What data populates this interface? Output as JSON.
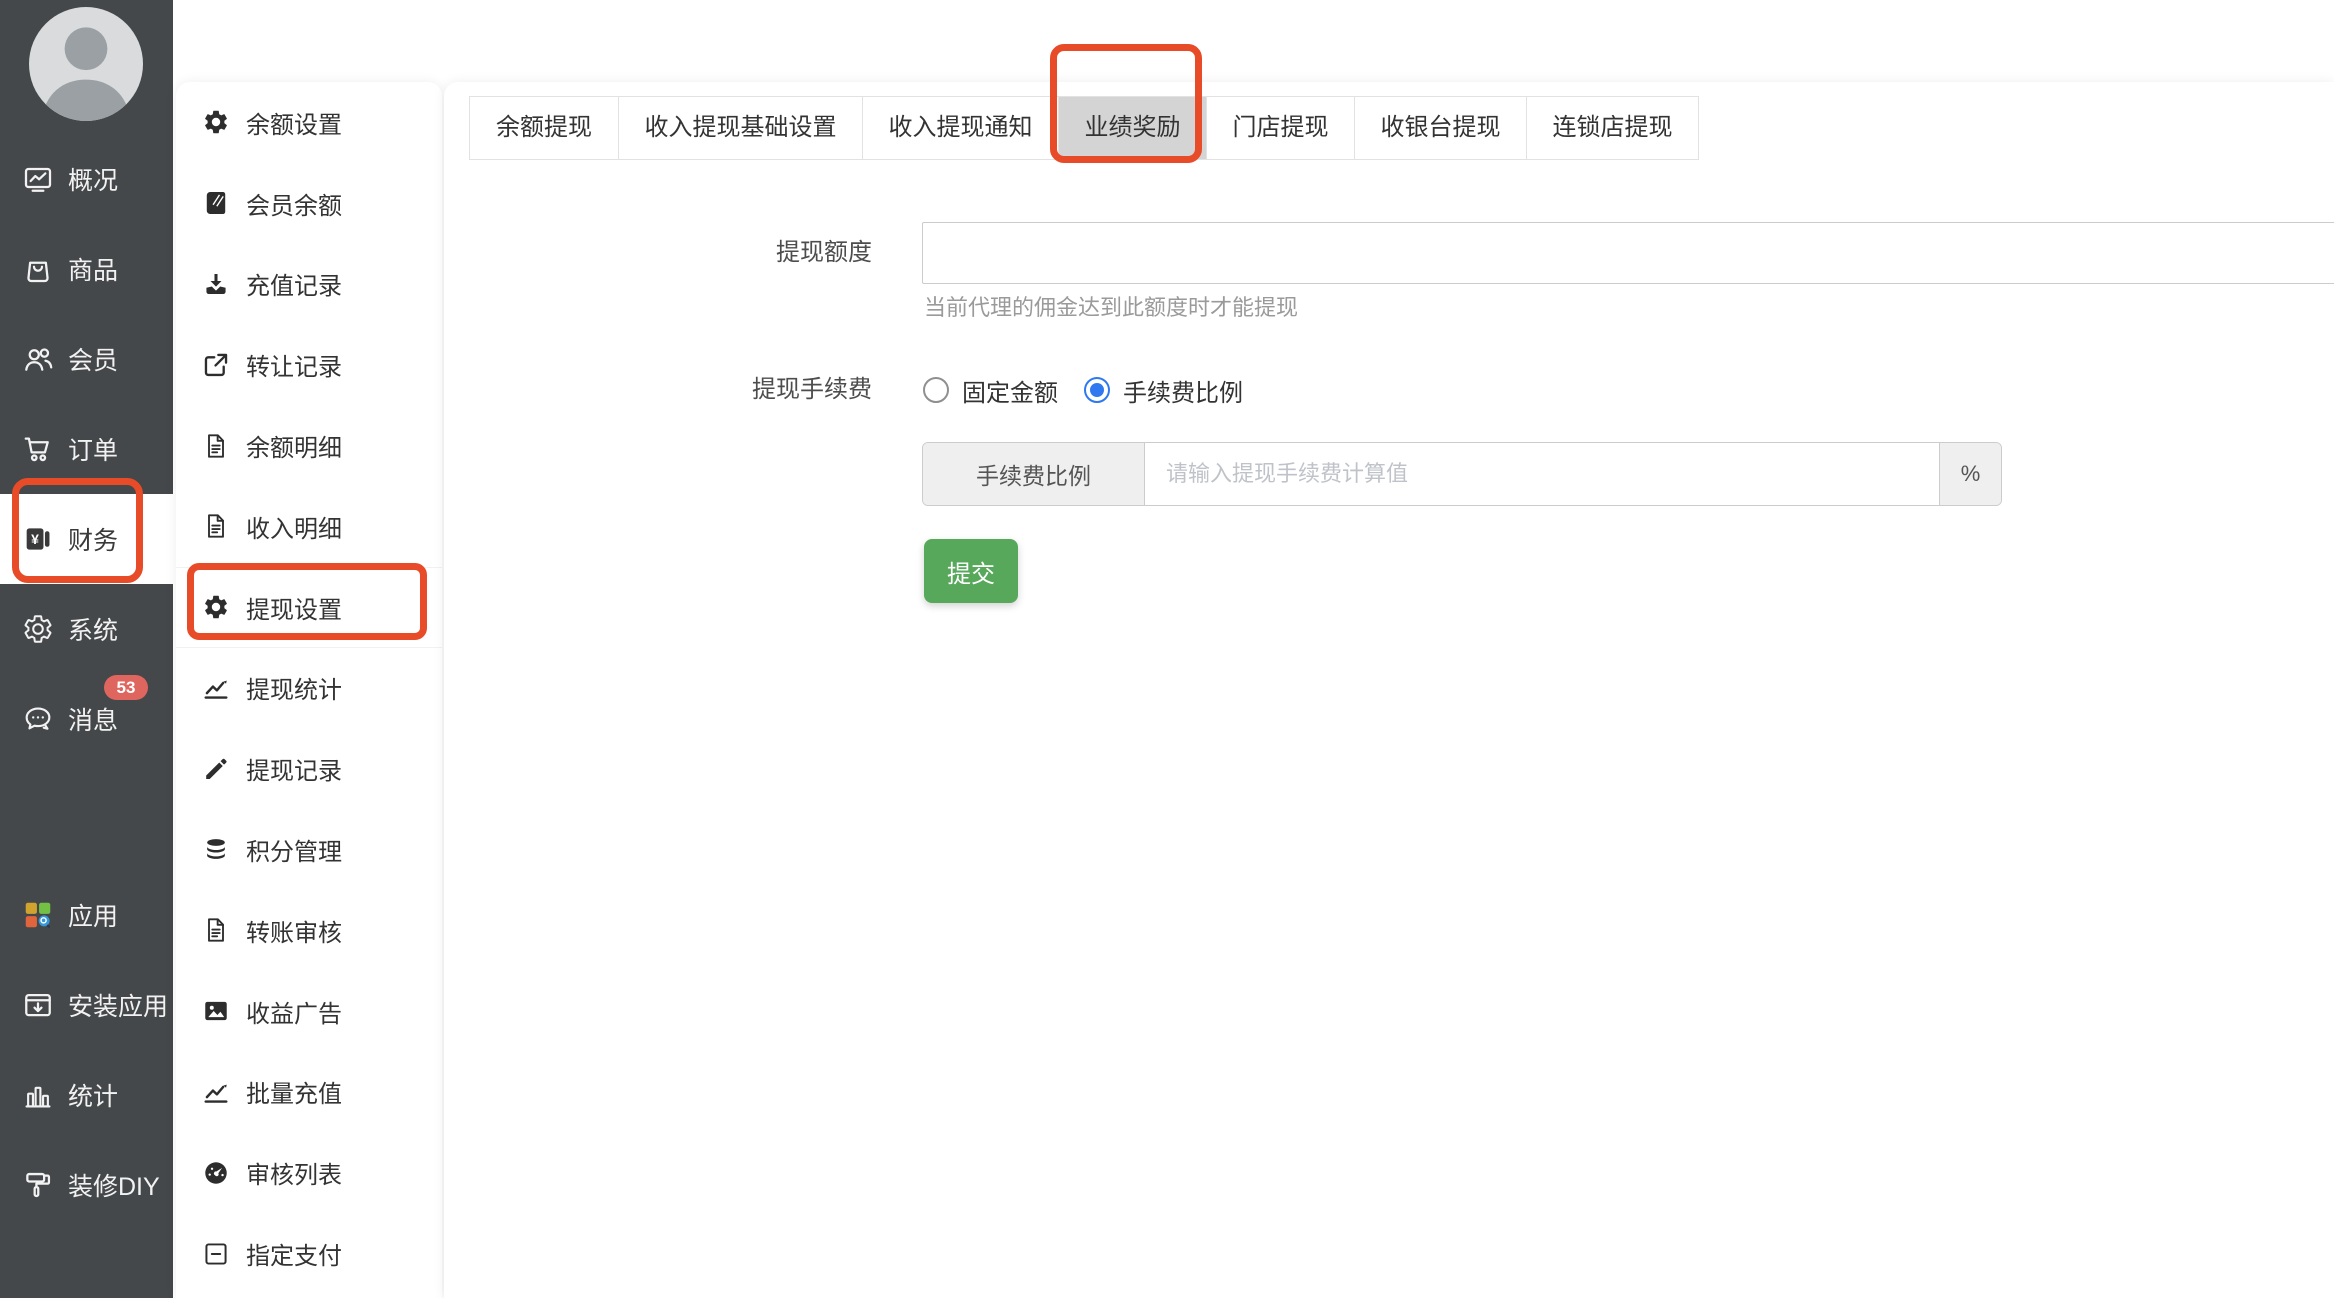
{
  "colors": {
    "sidebar_bg": "#45484a",
    "annotation_red": "#e74b27",
    "submit_green": "#58a85c",
    "radio_blue": "#2f78f0",
    "badge_red": "#df655f",
    "active_tab_gray": "#d4d4d4"
  },
  "sidebar": {
    "items": [
      {
        "name": "overview",
        "label": "概况",
        "icon": "overview"
      },
      {
        "name": "goods",
        "label": "商品",
        "icon": "goods"
      },
      {
        "name": "members",
        "label": "会员",
        "icon": "members"
      },
      {
        "name": "orders",
        "label": "订单",
        "icon": "orders"
      },
      {
        "name": "finance",
        "label": "财务",
        "icon": "finance",
        "active": true
      },
      {
        "name": "system",
        "label": "系统",
        "icon": "system"
      },
      {
        "name": "messages",
        "label": "消息",
        "icon": "messages",
        "badge": "53"
      },
      {
        "name": "apps",
        "label": "应用",
        "icon": "apps",
        "gap_before": true
      },
      {
        "name": "install-app",
        "label": "安装应用",
        "icon": "install"
      },
      {
        "name": "stats",
        "label": "统计",
        "icon": "stats"
      },
      {
        "name": "decorate-diy",
        "label": "装修DIY",
        "icon": "diy"
      }
    ]
  },
  "submenu": {
    "items": [
      {
        "name": "balance-settings",
        "label": "余额设置",
        "icon": "gear"
      },
      {
        "name": "member-balance",
        "label": "会员余额",
        "icon": "book"
      },
      {
        "name": "recharge-records",
        "label": "充值记录",
        "icon": "download"
      },
      {
        "name": "transfer-records",
        "label": "转让记录",
        "icon": "external"
      },
      {
        "name": "balance-details",
        "label": "余额明细",
        "icon": "file"
      },
      {
        "name": "income-details",
        "label": "收入明细",
        "icon": "file"
      },
      {
        "name": "withdraw-settings",
        "label": "提现设置",
        "icon": "gear",
        "active": true
      },
      {
        "name": "withdraw-stats",
        "label": "提现统计",
        "icon": "chart"
      },
      {
        "name": "withdraw-records",
        "label": "提现记录",
        "icon": "pencil"
      },
      {
        "name": "points-management",
        "label": "积分管理",
        "icon": "coins"
      },
      {
        "name": "transfer-audit",
        "label": "转账审核",
        "icon": "file"
      },
      {
        "name": "income-ads",
        "label": "收益广告",
        "icon": "image"
      },
      {
        "name": "batch-recharge",
        "label": "批量充值",
        "icon": "chart"
      },
      {
        "name": "audit-list",
        "label": "审核列表",
        "icon": "gauge"
      },
      {
        "name": "designated-payment",
        "label": "指定支付",
        "icon": "minus-square"
      }
    ]
  },
  "tabs": {
    "items": [
      {
        "name": "balance-withdraw",
        "label": "余额提现"
      },
      {
        "name": "income-withdraw-basic",
        "label": "收入提现基础设置"
      },
      {
        "name": "income-withdraw-notice",
        "label": "收入提现通知"
      },
      {
        "name": "performance-bonus",
        "label": "业绩奖励",
        "active": true
      },
      {
        "name": "store-withdraw",
        "label": "门店提现"
      },
      {
        "name": "cashier-withdraw",
        "label": "收银台提现"
      },
      {
        "name": "chain-store-withdraw",
        "label": "连锁店提现"
      }
    ]
  },
  "form": {
    "withdraw_quota": {
      "label": "提现额度",
      "value": "",
      "helper": "当前代理的佣金达到此额度时才能提现"
    },
    "fee": {
      "label": "提现手续费",
      "options": [
        {
          "label": "固定金额",
          "selected": false
        },
        {
          "label": "手续费比例",
          "selected": true
        }
      ],
      "input_addon": "手续费比例",
      "input_placeholder": "请输入提现手续费计算值",
      "unit": "%"
    },
    "submit_label": "提交"
  }
}
